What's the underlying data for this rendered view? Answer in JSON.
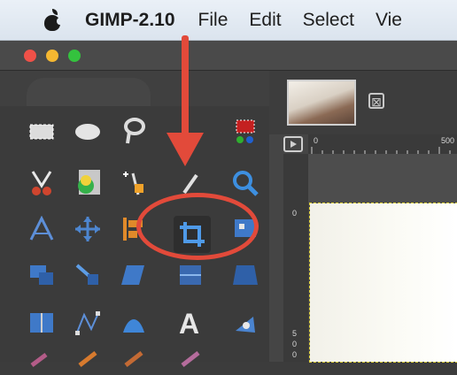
{
  "menubar": {
    "apple_icon": "apple-logo-icon",
    "app_name": "GIMP-2.10",
    "items": [
      "File",
      "Edit",
      "Select",
      "Vie"
    ]
  },
  "window": {
    "traffic_lights": [
      "close",
      "minimize",
      "zoom"
    ],
    "colors": {
      "close": "#ef5148",
      "minimize": "#f5b731",
      "zoom": "#34c23e"
    }
  },
  "image_tab": {
    "close_glyph": "⊠"
  },
  "rulers": {
    "horizontal_ticks": [
      "0",
      "500"
    ],
    "vertical_ticks": [
      "0",
      "5",
      "0",
      "0"
    ]
  },
  "toolbox": {
    "tools": [
      "rectangle-select-icon",
      "ellipse-select-icon",
      "free-select-icon",
      "color-picker-select-icon",
      "scissors-select-icon",
      "foreground-select-icon",
      "fuzzy-select-icon",
      "color-picker-icon",
      "zoom-icon",
      "measure-icon",
      "move-icon",
      "align-icon",
      "crop-icon",
      "transform-icon",
      "unified-transform-icon",
      "handle-transform-icon",
      "shear-icon",
      "warp-icon",
      "perspective-icon",
      "flip-icon",
      "path-icon",
      "text-icon",
      "bucket-fill-icon",
      "blend-icon",
      "pencil-icon",
      "paintbrush-icon",
      "eraser-icon",
      "airbrush-icon"
    ],
    "highlighted_tool": "crop-icon"
  },
  "annotation": {
    "accent_color": "#e24a3a",
    "arrow": "arrow-down-icon",
    "ring": "highlight-ring"
  }
}
